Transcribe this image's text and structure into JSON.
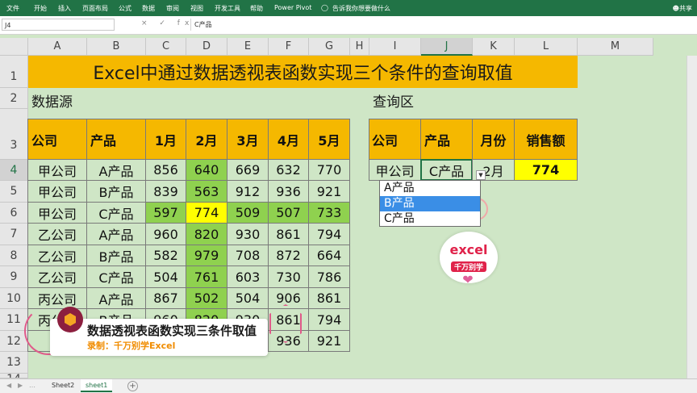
{
  "ribbon": {
    "tabs": [
      "文件",
      "开始",
      "插入",
      "页面布局",
      "公式",
      "数据",
      "审阅",
      "视图",
      "开发工具",
      "帮助",
      "Power Pivot"
    ],
    "tell_me": "告诉我你想要做什么",
    "share": "共享"
  },
  "formula_bar": {
    "name_box": "J4",
    "fx": "× ✓ fx",
    "value": "C产品"
  },
  "columns": [
    "A",
    "B",
    "C",
    "D",
    "E",
    "F",
    "G",
    "H",
    "I",
    "J",
    "K",
    "L",
    "M"
  ],
  "rows": [
    "1",
    "2",
    "3",
    "4",
    "5",
    "6",
    "7",
    "8",
    "9",
    "10",
    "11",
    "12",
    "13",
    "14"
  ],
  "title": "Excel中通过数据透视表函数实现三个条件的查询取值",
  "source_label": "数据源",
  "query_label": "查询区",
  "source_headers": [
    "公司",
    "产品",
    "1月",
    "2月",
    "3月",
    "4月",
    "5月"
  ],
  "source_rows": [
    [
      "甲公司",
      "A产品",
      "856",
      "640",
      "669",
      "632",
      "770"
    ],
    [
      "甲公司",
      "B产品",
      "839",
      "563",
      "912",
      "936",
      "921"
    ],
    [
      "甲公司",
      "C产品",
      "597",
      "774",
      "509",
      "507",
      "733"
    ],
    [
      "乙公司",
      "A产品",
      "960",
      "820",
      "930",
      "861",
      "794"
    ],
    [
      "乙公司",
      "B产品",
      "582",
      "979",
      "708",
      "872",
      "664"
    ],
    [
      "乙公司",
      "C产品",
      "504",
      "761",
      "603",
      "730",
      "786"
    ],
    [
      "丙公司",
      "A产品",
      "867",
      "502",
      "504",
      "906",
      "861"
    ],
    [
      "丙公司",
      "B产品",
      "960",
      "820",
      "930",
      "861",
      "794"
    ],
    [
      "丙",
      "",
      "",
      "",
      "",
      "936",
      "921"
    ]
  ],
  "query_headers": [
    "公司",
    "产品",
    "月份",
    "销售额"
  ],
  "query_values": [
    "甲公司",
    "C产品",
    "2月",
    "774"
  ],
  "dropdown_options": [
    "A产品",
    "B产品",
    "C产品"
  ],
  "dropdown_highlighted": 1,
  "logo": {
    "line1": "excel",
    "line2": "千万别学"
  },
  "caption": {
    "title": "数据透视表函数实现三条件取值",
    "author": "录制：千万别学Excel"
  },
  "sheets": [
    "Sheet2",
    "sheet1"
  ],
  "active_sheet": "sheet1",
  "colors": {
    "header": "#f5b800",
    "highlight_green": "#8fd14f",
    "highlight_yellow": "#ffff00",
    "excel_green": "#217346"
  }
}
